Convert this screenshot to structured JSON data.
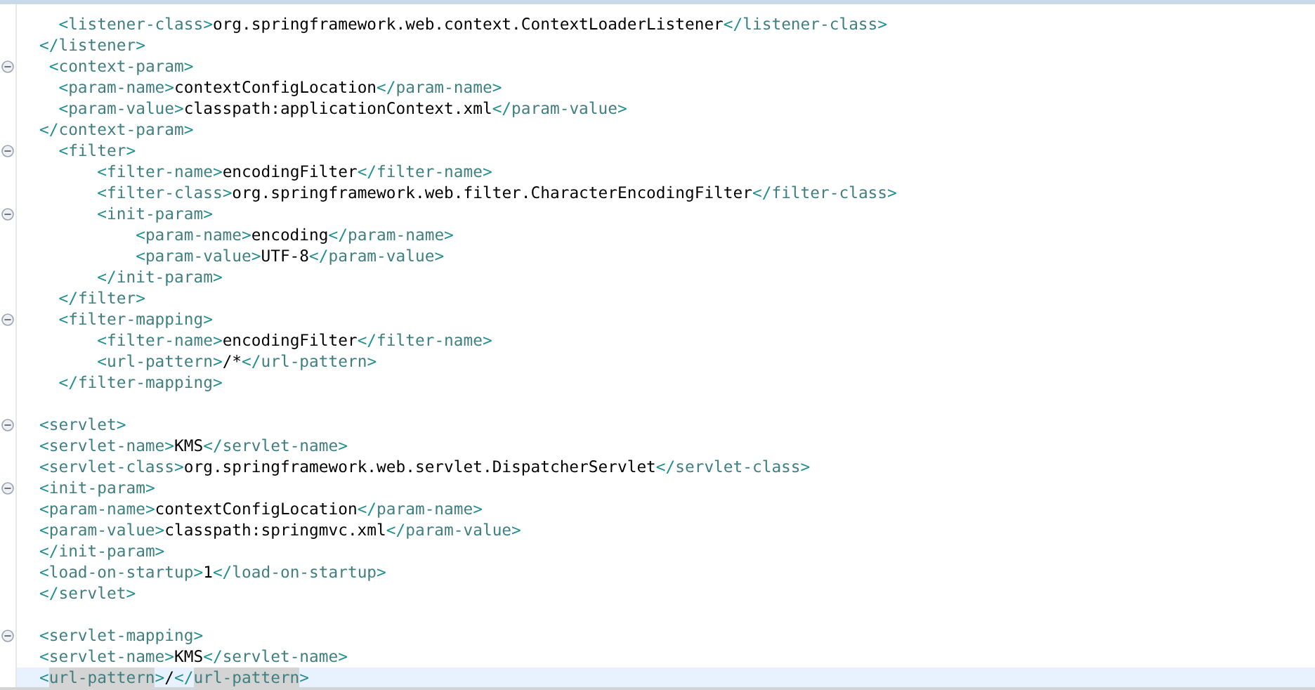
{
  "editor": {
    "lines": [
      {
        "code": "  <listener-class>org.springframework.web.context.ContextLoaderListener</listener-class>",
        "fold": false,
        "current": false
      },
      {
        "code": "</listener>",
        "fold": false,
        "current": false
      },
      {
        "code": " <context-param>",
        "fold": true,
        "current": false
      },
      {
        "code": "  <param-name>contextConfigLocation</param-name>",
        "fold": false,
        "current": false
      },
      {
        "code": "  <param-value>classpath:applicationContext.xml</param-value>",
        "fold": false,
        "current": false
      },
      {
        "code": "</context-param>",
        "fold": false,
        "current": false
      },
      {
        "code": "  <filter>",
        "fold": true,
        "current": false
      },
      {
        "code": "      <filter-name>encodingFilter</filter-name>",
        "fold": false,
        "current": false
      },
      {
        "code": "      <filter-class>org.springframework.web.filter.CharacterEncodingFilter</filter-class>",
        "fold": false,
        "current": false
      },
      {
        "code": "      <init-param>",
        "fold": true,
        "current": false
      },
      {
        "code": "          <param-name>encoding</param-name>",
        "fold": false,
        "current": false
      },
      {
        "code": "          <param-value>UTF-8</param-value>",
        "fold": false,
        "current": false
      },
      {
        "code": "      </init-param>",
        "fold": false,
        "current": false
      },
      {
        "code": "  </filter>",
        "fold": false,
        "current": false
      },
      {
        "code": "  <filter-mapping>",
        "fold": true,
        "current": false
      },
      {
        "code": "      <filter-name>encodingFilter</filter-name>",
        "fold": false,
        "current": false
      },
      {
        "code": "      <url-pattern>/*</url-pattern>",
        "fold": false,
        "current": false
      },
      {
        "code": "  </filter-mapping>",
        "fold": false,
        "current": false
      },
      {
        "fold": false,
        "current": false
      },
      {
        "code": "<servlet>",
        "fold": true,
        "current": false
      },
      {
        "code": "<servlet-name>KMS</servlet-name>",
        "fold": false,
        "current": false
      },
      {
        "code": "<servlet-class>org.springframework.web.servlet.DispatcherServlet</servlet-class>",
        "fold": false,
        "current": false
      },
      {
        "code": "<init-param>",
        "fold": true,
        "current": false
      },
      {
        "code": "<param-name>contextConfigLocation</param-name>",
        "fold": false,
        "current": false
      },
      {
        "code": "<param-value>classpath:springmvc.xml</param-value>",
        "fold": false,
        "current": false
      },
      {
        "code": "</init-param>",
        "fold": false,
        "current": false
      },
      {
        "code": "<load-on-startup>1</load-on-startup>",
        "fold": false,
        "current": false
      },
      {
        "code": "</servlet>",
        "fold": false,
        "current": false
      },
      {
        "fold": false,
        "current": false
      },
      {
        "code": "<servlet-mapping>",
        "fold": true,
        "current": false
      },
      {
        "code": "<servlet-name>KMS</servlet-name>",
        "fold": false,
        "current": false
      },
      {
        "code": "<url-pattern>/</url-pattern>",
        "fold": false,
        "current": true
      }
    ]
  }
}
